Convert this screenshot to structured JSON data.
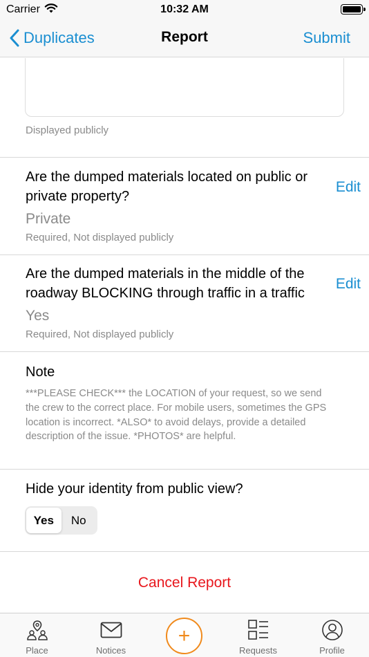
{
  "status_bar": {
    "carrier": "Carrier",
    "time": "10:32 AM"
  },
  "nav": {
    "back_label": "Duplicates",
    "title": "Report",
    "submit_label": "Submit"
  },
  "description_field": {
    "helper": "Displayed publicly"
  },
  "questions": [
    {
      "text": "Are the dumped materials located on public or private property?",
      "answer": "Private",
      "helper": "Required, Not displayed publicly",
      "edit_label": "Edit"
    },
    {
      "text": "Are the dumped materials in the middle of the roadway BLOCKING through traffic in a traffic",
      "answer": "Yes",
      "helper": "Required, Not displayed publicly",
      "edit_label": "Edit"
    }
  ],
  "note": {
    "title": "Note",
    "text": "***PLEASE CHECK*** the LOCATION of your request, so we send the crew to the correct place. For mobile users, sometimes the GPS location is incorrect. *ALSO* to avoid delays, provide a detailed description of the issue. *PHOTOS* are helpful."
  },
  "identity": {
    "label": "Hide your identity from public view?",
    "options": [
      "Yes",
      "No"
    ],
    "selected": "Yes"
  },
  "cancel_label": "Cancel Report",
  "tab_bar": {
    "tabs": [
      {
        "label": "Place",
        "icon": "place-icon"
      },
      {
        "label": "Notices",
        "icon": "mail-icon"
      },
      {
        "label": "",
        "icon": "plus-icon"
      },
      {
        "label": "Requests",
        "icon": "list-icon"
      },
      {
        "label": "Profile",
        "icon": "profile-icon"
      }
    ],
    "plus_symbol": "+"
  },
  "colors": {
    "accent": "#1a8ed1",
    "danger": "#e8161c",
    "plus": "#f08a1c"
  }
}
